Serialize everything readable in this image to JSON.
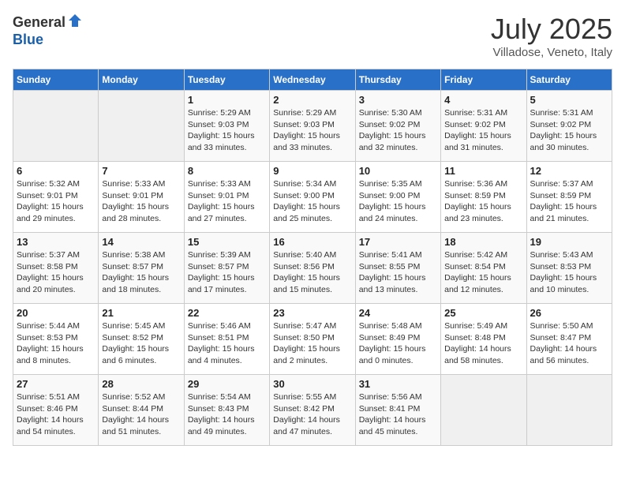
{
  "header": {
    "logo_general": "General",
    "logo_blue": "Blue",
    "month_year": "July 2025",
    "location": "Villadose, Veneto, Italy"
  },
  "days_of_week": [
    "Sunday",
    "Monday",
    "Tuesday",
    "Wednesday",
    "Thursday",
    "Friday",
    "Saturday"
  ],
  "weeks": [
    [
      {
        "day": "",
        "empty": true
      },
      {
        "day": "",
        "empty": true
      },
      {
        "day": "1",
        "sunrise": "Sunrise: 5:29 AM",
        "sunset": "Sunset: 9:03 PM",
        "daylight": "Daylight: 15 hours and 33 minutes."
      },
      {
        "day": "2",
        "sunrise": "Sunrise: 5:29 AM",
        "sunset": "Sunset: 9:03 PM",
        "daylight": "Daylight: 15 hours and 33 minutes."
      },
      {
        "day": "3",
        "sunrise": "Sunrise: 5:30 AM",
        "sunset": "Sunset: 9:02 PM",
        "daylight": "Daylight: 15 hours and 32 minutes."
      },
      {
        "day": "4",
        "sunrise": "Sunrise: 5:31 AM",
        "sunset": "Sunset: 9:02 PM",
        "daylight": "Daylight: 15 hours and 31 minutes."
      },
      {
        "day": "5",
        "sunrise": "Sunrise: 5:31 AM",
        "sunset": "Sunset: 9:02 PM",
        "daylight": "Daylight: 15 hours and 30 minutes."
      }
    ],
    [
      {
        "day": "6",
        "sunrise": "Sunrise: 5:32 AM",
        "sunset": "Sunset: 9:01 PM",
        "daylight": "Daylight: 15 hours and 29 minutes."
      },
      {
        "day": "7",
        "sunrise": "Sunrise: 5:33 AM",
        "sunset": "Sunset: 9:01 PM",
        "daylight": "Daylight: 15 hours and 28 minutes."
      },
      {
        "day": "8",
        "sunrise": "Sunrise: 5:33 AM",
        "sunset": "Sunset: 9:01 PM",
        "daylight": "Daylight: 15 hours and 27 minutes."
      },
      {
        "day": "9",
        "sunrise": "Sunrise: 5:34 AM",
        "sunset": "Sunset: 9:00 PM",
        "daylight": "Daylight: 15 hours and 25 minutes."
      },
      {
        "day": "10",
        "sunrise": "Sunrise: 5:35 AM",
        "sunset": "Sunset: 9:00 PM",
        "daylight": "Daylight: 15 hours and 24 minutes."
      },
      {
        "day": "11",
        "sunrise": "Sunrise: 5:36 AM",
        "sunset": "Sunset: 8:59 PM",
        "daylight": "Daylight: 15 hours and 23 minutes."
      },
      {
        "day": "12",
        "sunrise": "Sunrise: 5:37 AM",
        "sunset": "Sunset: 8:59 PM",
        "daylight": "Daylight: 15 hours and 21 minutes."
      }
    ],
    [
      {
        "day": "13",
        "sunrise": "Sunrise: 5:37 AM",
        "sunset": "Sunset: 8:58 PM",
        "daylight": "Daylight: 15 hours and 20 minutes."
      },
      {
        "day": "14",
        "sunrise": "Sunrise: 5:38 AM",
        "sunset": "Sunset: 8:57 PM",
        "daylight": "Daylight: 15 hours and 18 minutes."
      },
      {
        "day": "15",
        "sunrise": "Sunrise: 5:39 AM",
        "sunset": "Sunset: 8:57 PM",
        "daylight": "Daylight: 15 hours and 17 minutes."
      },
      {
        "day": "16",
        "sunrise": "Sunrise: 5:40 AM",
        "sunset": "Sunset: 8:56 PM",
        "daylight": "Daylight: 15 hours and 15 minutes."
      },
      {
        "day": "17",
        "sunrise": "Sunrise: 5:41 AM",
        "sunset": "Sunset: 8:55 PM",
        "daylight": "Daylight: 15 hours and 13 minutes."
      },
      {
        "day": "18",
        "sunrise": "Sunrise: 5:42 AM",
        "sunset": "Sunset: 8:54 PM",
        "daylight": "Daylight: 15 hours and 12 minutes."
      },
      {
        "day": "19",
        "sunrise": "Sunrise: 5:43 AM",
        "sunset": "Sunset: 8:53 PM",
        "daylight": "Daylight: 15 hours and 10 minutes."
      }
    ],
    [
      {
        "day": "20",
        "sunrise": "Sunrise: 5:44 AM",
        "sunset": "Sunset: 8:53 PM",
        "daylight": "Daylight: 15 hours and 8 minutes."
      },
      {
        "day": "21",
        "sunrise": "Sunrise: 5:45 AM",
        "sunset": "Sunset: 8:52 PM",
        "daylight": "Daylight: 15 hours and 6 minutes."
      },
      {
        "day": "22",
        "sunrise": "Sunrise: 5:46 AM",
        "sunset": "Sunset: 8:51 PM",
        "daylight": "Daylight: 15 hours and 4 minutes."
      },
      {
        "day": "23",
        "sunrise": "Sunrise: 5:47 AM",
        "sunset": "Sunset: 8:50 PM",
        "daylight": "Daylight: 15 hours and 2 minutes."
      },
      {
        "day": "24",
        "sunrise": "Sunrise: 5:48 AM",
        "sunset": "Sunset: 8:49 PM",
        "daylight": "Daylight: 15 hours and 0 minutes."
      },
      {
        "day": "25",
        "sunrise": "Sunrise: 5:49 AM",
        "sunset": "Sunset: 8:48 PM",
        "daylight": "Daylight: 14 hours and 58 minutes."
      },
      {
        "day": "26",
        "sunrise": "Sunrise: 5:50 AM",
        "sunset": "Sunset: 8:47 PM",
        "daylight": "Daylight: 14 hours and 56 minutes."
      }
    ],
    [
      {
        "day": "27",
        "sunrise": "Sunrise: 5:51 AM",
        "sunset": "Sunset: 8:46 PM",
        "daylight": "Daylight: 14 hours and 54 minutes."
      },
      {
        "day": "28",
        "sunrise": "Sunrise: 5:52 AM",
        "sunset": "Sunset: 8:44 PM",
        "daylight": "Daylight: 14 hours and 51 minutes."
      },
      {
        "day": "29",
        "sunrise": "Sunrise: 5:54 AM",
        "sunset": "Sunset: 8:43 PM",
        "daylight": "Daylight: 14 hours and 49 minutes."
      },
      {
        "day": "30",
        "sunrise": "Sunrise: 5:55 AM",
        "sunset": "Sunset: 8:42 PM",
        "daylight": "Daylight: 14 hours and 47 minutes."
      },
      {
        "day": "31",
        "sunrise": "Sunrise: 5:56 AM",
        "sunset": "Sunset: 8:41 PM",
        "daylight": "Daylight: 14 hours and 45 minutes."
      },
      {
        "day": "",
        "empty": true
      },
      {
        "day": "",
        "empty": true
      }
    ]
  ]
}
